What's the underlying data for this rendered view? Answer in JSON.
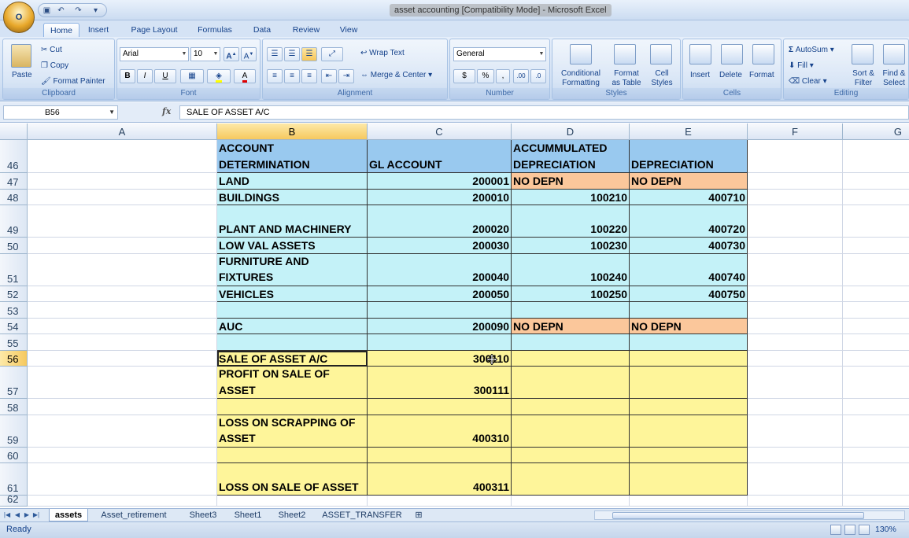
{
  "window": {
    "title": "asset accounting  [Compatibility Mode] - Microsoft Excel",
    "office_button": "O"
  },
  "ribbon": {
    "tabs": [
      "Home",
      "Insert",
      "Page Layout",
      "Formulas",
      "Data",
      "Review",
      "View"
    ],
    "active_tab": "Home",
    "clipboard": {
      "paste": "Paste",
      "cut": "Cut",
      "copy": "Copy",
      "format_painter": "Format Painter",
      "label": "Clipboard"
    },
    "font": {
      "name": "Arial",
      "size": "10",
      "bold": "B",
      "italic": "I",
      "underline": "U",
      "label": "Font"
    },
    "alignment": {
      "wrap_text": "Wrap Text",
      "merge_center": "Merge & Center",
      "label": "Alignment"
    },
    "number": {
      "format": "General",
      "currency": "$",
      "percent": "%",
      "comma": ",",
      "inc_dec": ".00",
      "dec_dec": ".0",
      "label": "Number"
    },
    "styles": {
      "conditional": "Conditional",
      "conditional2": "Formatting",
      "format_table": "Format",
      "format_table2": "as Table",
      "cell_styles": "Cell",
      "cell_styles2": "Styles",
      "label": "Styles"
    },
    "cells": {
      "insert": "Insert",
      "delete": "Delete",
      "format": "Format",
      "label": "Cells"
    },
    "editing": {
      "autosum": "AutoSum",
      "fill": "Fill",
      "clear": "Clear",
      "sort": "Sort &",
      "sort2": "Filter",
      "find": "Find &",
      "find2": "Select",
      "label": "Editing"
    }
  },
  "formula_bar": {
    "name_box": "B56",
    "fx": "fx",
    "formula": "SALE OF ASSET A/C"
  },
  "columns": [
    "A",
    "B",
    "C",
    "D",
    "E",
    "F",
    "G"
  ],
  "rows": [
    {
      "num": "46",
      "B": "ACCOUNT DETERMINATION",
      "C": "GL ACCOUNT",
      "D": "ACCUMMULATED DEPRECIATION",
      "E": "DEPRECIATION"
    },
    {
      "num": "47",
      "B": "LAND",
      "C": "200001",
      "D": "NO DEPN",
      "E": "NO DEPN"
    },
    {
      "num": "48",
      "B": "BUILDINGS",
      "C": "200010",
      "D": "100210",
      "E": "400710"
    },
    {
      "num": "49",
      "B": "PLANT AND MACHINERY",
      "C": "200020",
      "D": "100220",
      "E": "400720"
    },
    {
      "num": "50",
      "B": "LOW VAL ASSETS",
      "C": "200030",
      "D": "100230",
      "E": "400730"
    },
    {
      "num": "51",
      "B": "FURNITURE AND FIXTURES",
      "C": "200040",
      "D": "100240",
      "E": "400740"
    },
    {
      "num": "52",
      "B": "VEHICLES",
      "C": "200050",
      "D": "100250",
      "E": "400750"
    },
    {
      "num": "53",
      "B": "",
      "C": "",
      "D": "",
      "E": ""
    },
    {
      "num": "54",
      "B": "AUC",
      "C": "200090",
      "D": "NO DEPN",
      "E": "NO DEPN"
    },
    {
      "num": "55",
      "B": "",
      "C": "",
      "D": "",
      "E": ""
    },
    {
      "num": "56",
      "B": "SALE OF ASSET A/C",
      "C": "300110",
      "D": "",
      "E": ""
    },
    {
      "num": "57",
      "B": "PROFIT ON SALE OF ASSET",
      "C": "300111",
      "D": "",
      "E": ""
    },
    {
      "num": "58",
      "B": "",
      "C": "",
      "D": "",
      "E": ""
    },
    {
      "num": "59",
      "B": "LOSS ON SCRAPPING OF ASSET",
      "C": "400310",
      "D": "",
      "E": ""
    },
    {
      "num": "60",
      "B": "",
      "C": "",
      "D": "",
      "E": ""
    },
    {
      "num": "61",
      "B": "LOSS ON SALE OF ASSET",
      "C": "400311",
      "D": "",
      "E": ""
    },
    {
      "num": "62",
      "B": "",
      "C": "",
      "D": "",
      "E": ""
    }
  ],
  "sheet_tabs": [
    "assets",
    "Asset_retirement",
    "Sheet3",
    "Sheet1",
    "Sheet2",
    "ASSET_TRANSFER"
  ],
  "active_sheet": "assets",
  "status": {
    "text": "Ready",
    "zoom": "130%"
  },
  "colors": {
    "header_blue": "#99c9ef",
    "light_blue": "#c4f2f8",
    "orange": "#fbc79b",
    "yellow": "#fef59a"
  }
}
